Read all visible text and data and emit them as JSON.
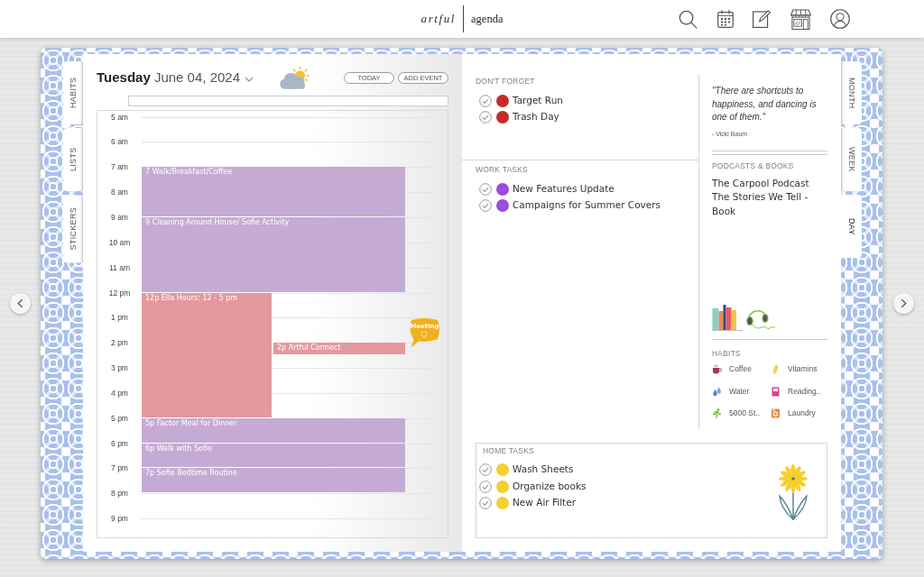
{
  "top_bar": {
    "logo": [
      "artful",
      "agenda"
    ]
  },
  "planner": {
    "left_tabs": [
      {
        "label": "HABITS",
        "selected": false
      },
      {
        "label": "LISTS",
        "selected": false
      },
      {
        "label": "STICKERS",
        "selected": false
      }
    ],
    "right_tabs": [
      {
        "label": "MONTH",
        "selected": false
      },
      {
        "label": "WEEK",
        "selected": false
      },
      {
        "label": "DAY",
        "selected": true
      }
    ],
    "day_page": {
      "weekday": "Tuesday",
      "date": "June 04, 2024",
      "buttons": [
        "TODAY",
        "ADD EVENT"
      ],
      "hours": [
        {
          "label": "5 am"
        },
        {
          "label": "6 am"
        },
        {
          "label": "7 am",
          "events": [
            {
              "text": "7 Walk/Breakfast/Coffee",
              "color": "#c5abd4",
              "kind": "twohour"
            }
          ]
        },
        {
          "label": "8 am"
        },
        {
          "label": "9 am",
          "events": [
            {
              "text": "9 Cleaning Around House/ Sofie Activity",
              "color": "#c5abd4",
              "kind": "threehour"
            }
          ]
        },
        {
          "label": "10 am"
        },
        {
          "label": "11 am"
        },
        {
          "label": "12 pm",
          "events": [
            {
              "text": "12p Ella Hours: 12 - 5 pm",
              "color": "#e3999e",
              "kind": "fivehour"
            }
          ]
        },
        {
          "label": "1 pm"
        },
        {
          "label": "2 pm",
          "events": [
            {
              "text": "2p Artful Connect",
              "color": "#e3999e",
              "kind": "halfhour"
            }
          ]
        },
        {
          "label": "3 pm"
        },
        {
          "label": "4 pm"
        },
        {
          "label": "5 pm",
          "events": [
            {
              "text": "5p Factor Meal for Dinner",
              "color": "#c5abd4",
              "kind": "onehour"
            }
          ]
        },
        {
          "label": "6 pm",
          "events": [
            {
              "text": "6p Walk with Sofie",
              "color": "#c5abd4",
              "kind": "onehour"
            }
          ]
        },
        {
          "label": "7 pm",
          "events": [
            {
              "text": "7p Sofie Bedtime Routine",
              "color": "#c5abd4",
              "kind": "onehour"
            }
          ]
        },
        {
          "label": "8 pm"
        },
        {
          "label": "9 pm"
        }
      ],
      "sticker": {
        "text": "Meeting"
      }
    },
    "right_page": {
      "dont_forget": {
        "title": "DON'T FORGET",
        "tasks": [
          {
            "text": "Target Run",
            "color": "#c62a2a"
          },
          {
            "text": "Trash Day",
            "color": "#c62a2a"
          }
        ]
      },
      "work_tasks": {
        "title": "WORK TASKS",
        "tasks": [
          {
            "text": "New Features Update",
            "color": "#9b4ddd"
          },
          {
            "text": "Campaigns for Summer Covers",
            "color": "#9b4ddd"
          }
        ]
      },
      "quote": {
        "text": "\"There are shortcuts to happiness, and dancing is one of them.\"",
        "author": "- Vicki Baum"
      },
      "podcasts_books": {
        "title": "PODCASTS & BOOKS",
        "items": [
          "The Carpool Podcast",
          "The Stories We Tell - Book"
        ]
      },
      "habits": {
        "title": "HABITS",
        "items": [
          "Coffee",
          "Vitamins",
          "Water",
          "Reading..",
          "5000 St..",
          "Laundry"
        ]
      },
      "home_tasks": {
        "title": "HOME TASKS",
        "tasks": [
          {
            "text": "Wash Sheets",
            "color": "#f5cf2d"
          },
          {
            "text": "Organize books",
            "color": "#f5cf2d"
          },
          {
            "text": "New Air Filter",
            "color": "#f5cf2d"
          }
        ]
      }
    }
  }
}
